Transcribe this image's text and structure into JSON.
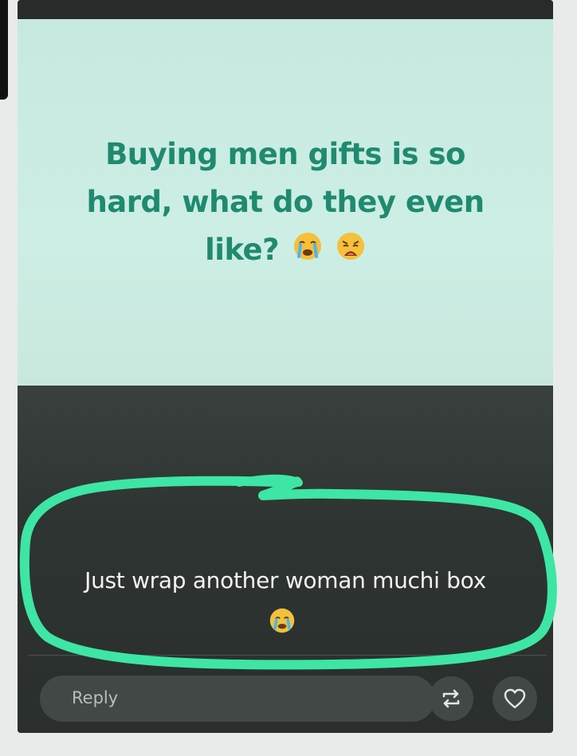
{
  "story": {
    "line1": "Buying men gifts is so",
    "line2": "hard, what do they even",
    "line3": "like?",
    "emoji_1": "crying-face",
    "emoji_2": "weary-face",
    "text_color": "#1f8a70",
    "background_color": "#c9ebe1"
  },
  "reply": {
    "text": "Just wrap another woman muchi box",
    "emoji": "crying-face",
    "highlight_color": "#3de6a4"
  },
  "composer": {
    "placeholder": "Reply",
    "share_icon": "repost-icon",
    "like_icon": "heart-icon"
  }
}
